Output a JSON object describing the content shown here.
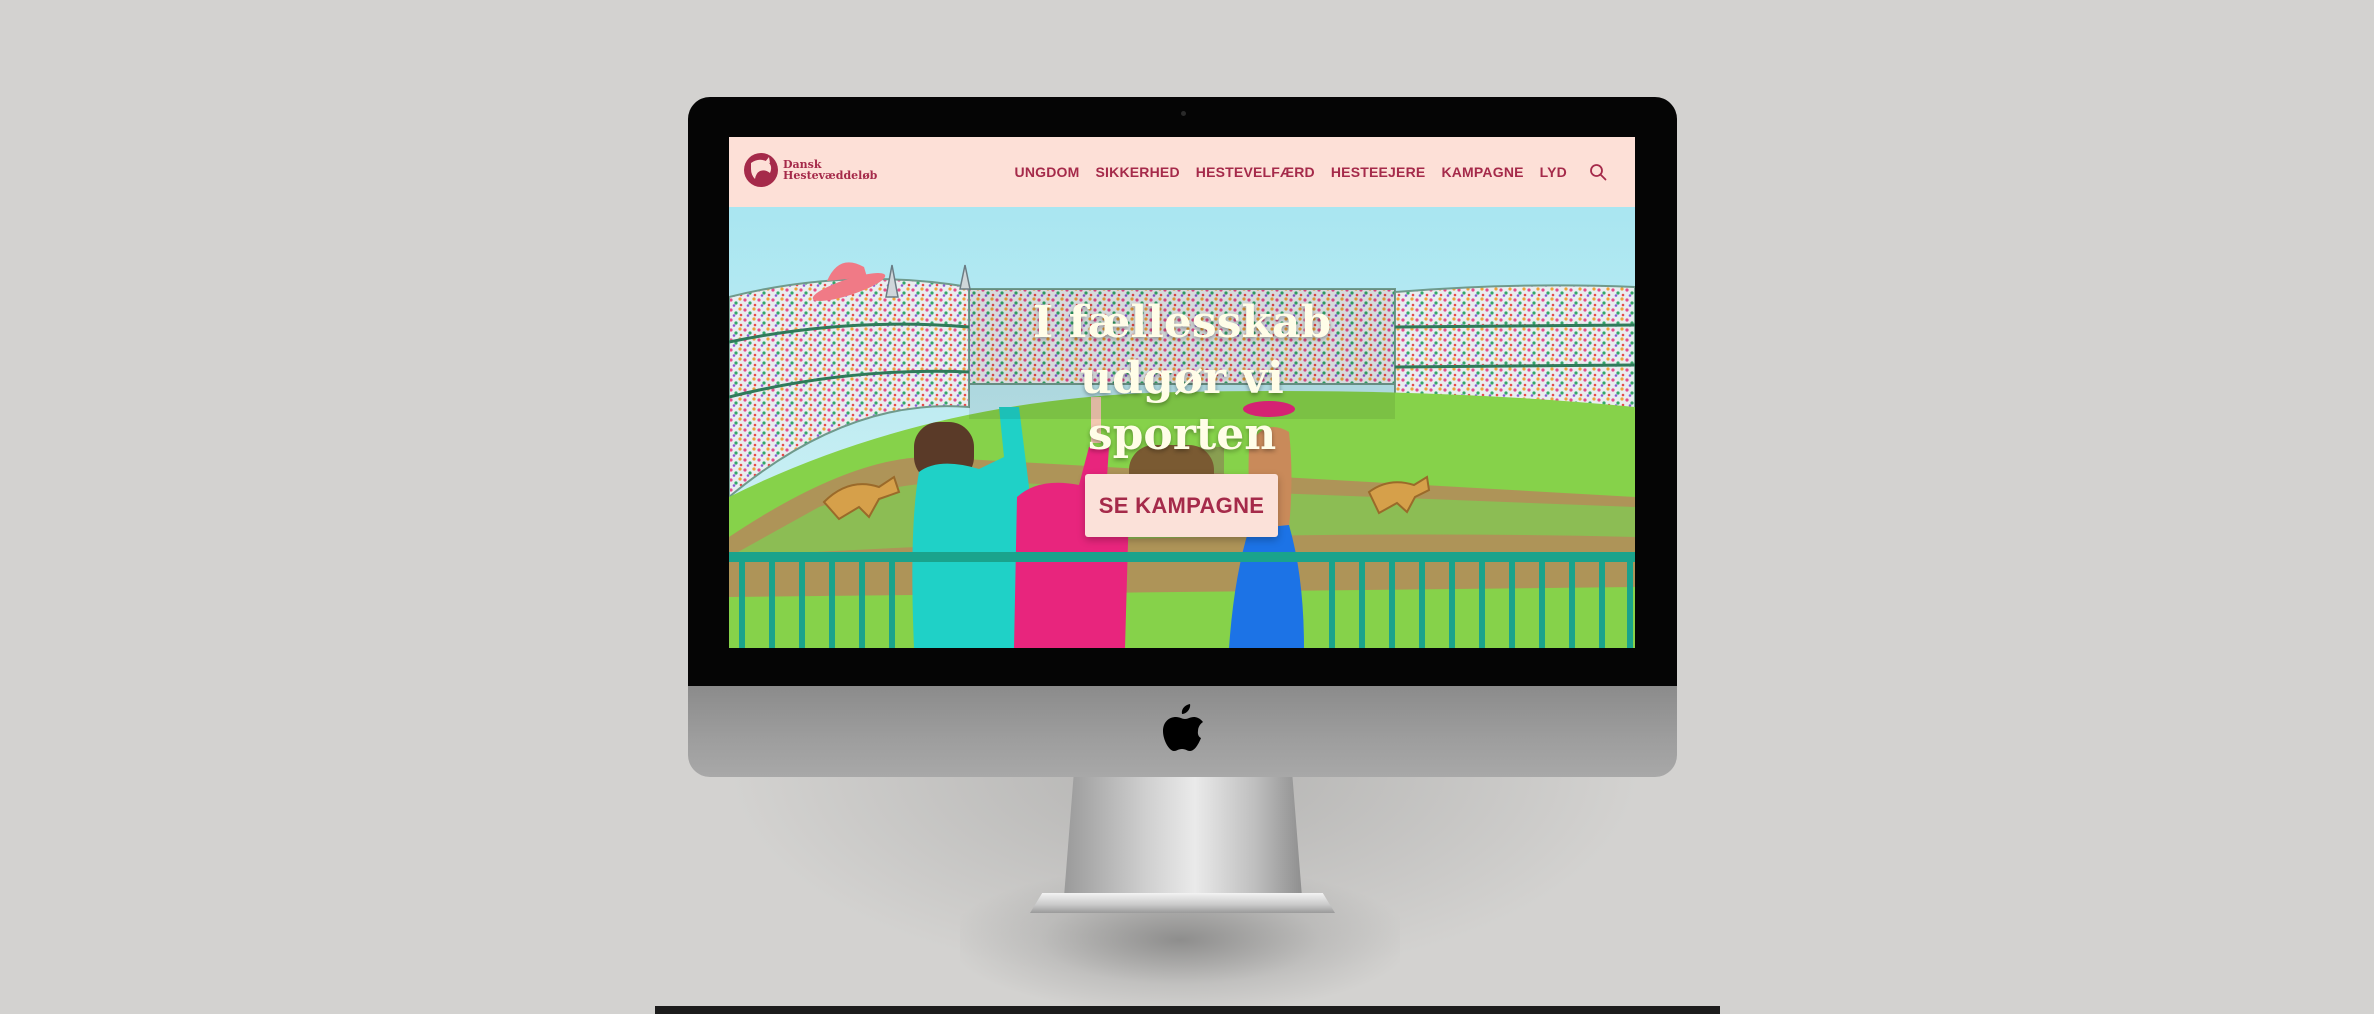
{
  "site": {
    "logo_line1": "Dansk",
    "logo_line2": "Hestevæddeløb"
  },
  "nav": {
    "items": [
      {
        "label": "UNGDOM"
      },
      {
        "label": "SIKKERHED"
      },
      {
        "label": "HESTEVELFÆRD"
      },
      {
        "label": "HESTEEJERE"
      },
      {
        "label": "KAMPAGNE"
      },
      {
        "label": "LYD"
      }
    ],
    "search_icon": "search-icon"
  },
  "hero": {
    "title_line1": "I fællesskab",
    "title_line2": "udgør vi sporten",
    "cta_label": "SE KAMPAGNE"
  },
  "colors": {
    "brand": "#a52a4a",
    "header_bg": "#fde0d7",
    "title": "#fffde8"
  }
}
